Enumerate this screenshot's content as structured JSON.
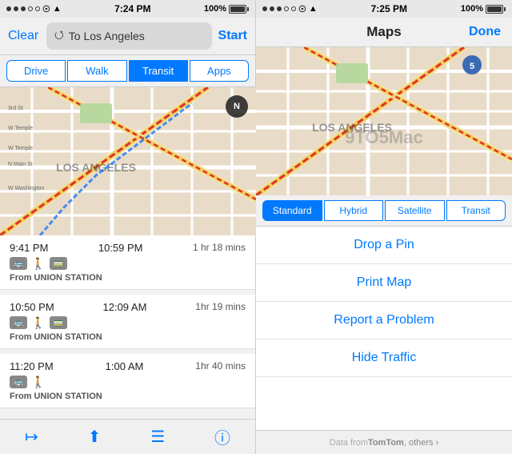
{
  "left": {
    "status": {
      "time": "7:24 PM",
      "signal_dots": 5,
      "battery_pct": 100,
      "wifi": true,
      "arrow": true
    },
    "nav": {
      "clear_label": "Clear",
      "destination": "To Los Angeles",
      "start_label": "Start"
    },
    "tabs": [
      {
        "label": "Drive",
        "active": false
      },
      {
        "label": "Walk",
        "active": false
      },
      {
        "label": "Transit",
        "active": true
      },
      {
        "label": "Apps",
        "active": false
      }
    ],
    "transit_items": [
      {
        "depart": "9:41 PM",
        "arrive": "10:59 PM",
        "duration": "1 hr 18 mins",
        "from": "From UNION STATION"
      },
      {
        "depart": "10:50 PM",
        "arrive": "12:09 AM",
        "duration": "1hr 19 mins",
        "from": "From UNION STATION"
      },
      {
        "depart": "11:20 PM",
        "arrive": "1:00 AM",
        "duration": "1hr 40 mins",
        "from": "From UNION STATION"
      }
    ],
    "toolbar": {
      "icons": [
        "location",
        "share",
        "list",
        "info"
      ]
    }
  },
  "right": {
    "status": {
      "time": "7:25 PM",
      "battery_pct": 100,
      "wifi": true,
      "arrow": true
    },
    "nav": {
      "title": "Maps",
      "done_label": "Done"
    },
    "map_types": [
      {
        "label": "Standard",
        "active": true
      },
      {
        "label": "Hybrid",
        "active": false
      },
      {
        "label": "Satellite",
        "active": false
      },
      {
        "label": "Transit",
        "active": false
      }
    ],
    "menu_items": [
      {
        "label": "Drop a Pin"
      },
      {
        "label": "Print Map"
      },
      {
        "label": "Report a Problem"
      },
      {
        "label": "Hide Traffic"
      }
    ],
    "watermark": "9TO5Mac",
    "footer": "Data from  TomTom",
    "footer_suffix": ", others ›"
  }
}
